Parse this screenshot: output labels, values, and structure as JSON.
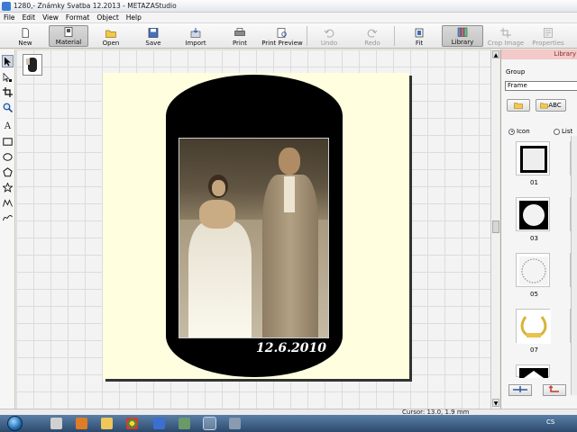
{
  "window": {
    "title": "1280,- Známky Svatba 12.2013 - METAZAStudio"
  },
  "menu": [
    "File",
    "Edit",
    "View",
    "Format",
    "Object",
    "Help"
  ],
  "toolbar": {
    "new": "New",
    "material": "Material",
    "open": "Open",
    "save": "Save",
    "import": "Import",
    "print": "Print",
    "print_preview": "Print Preview",
    "undo": "Undo",
    "redo": "Redo",
    "fit": "Fit",
    "library": "Library",
    "crop_image": "Crop Image",
    "properties": "Properties"
  },
  "tools": [
    "select-arrow-icon",
    "node-select-icon",
    "crop-icon",
    "zoom-icon",
    "text-icon",
    "rectangle-icon",
    "ellipse-icon",
    "pentagon-icon",
    "star-icon",
    "polyline-icon",
    "curve-icon"
  ],
  "tool_glyphs": {
    "text": "A"
  },
  "canvas": {
    "date_text": "12.6.2010"
  },
  "library": {
    "header": "Library",
    "group_label": "Group",
    "group_value": "Frame",
    "abc_button": "ABC",
    "view_icon": "Icon",
    "view_list": "List",
    "items": [
      {
        "label": "01"
      },
      {
        "label": "03"
      },
      {
        "label": "05"
      },
      {
        "label": "07"
      }
    ]
  },
  "status": {
    "cursor": "Cursor: 13.0, 1.9 mm"
  },
  "taskbar": {
    "tray_lang": "CS"
  },
  "colors": {
    "page": "#ffffe0",
    "frame": "#000000",
    "library_header": "#f3c9c9",
    "taskbar": "#2d4a6c"
  }
}
